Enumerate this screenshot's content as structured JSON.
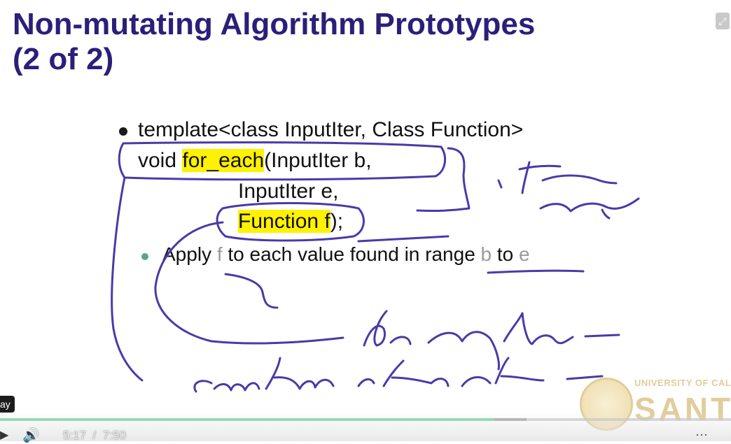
{
  "slide": {
    "title_line1": "Non-mutating Algorithm Prototypes",
    "title_line2": "(2 of 2)",
    "code": {
      "line1": "template<class InputIter, Class Function>",
      "line2_pre": "void ",
      "line2_hl": "for_each",
      "line2_post": "(InputIter b,",
      "line3": "InputIter e,",
      "line4_hl": "Function f",
      "line4_post": ");"
    },
    "sub_bullet": {
      "w1": "Apply ",
      "f": "f",
      "w2": " to each value found in range ",
      "b": "b",
      "w3": " to ",
      "e": "e"
    },
    "colors": {
      "title": "#2b1f7a",
      "highlight": "#fff200",
      "ink": "#4a3aa8",
      "sub_bullet_dot": "#5aa58a"
    }
  },
  "logo": {
    "univ": "UNIVERSITY OF CALI",
    "name": "SANTA CR"
  },
  "player": {
    "tooltip": "ay",
    "current_time": "5:17",
    "separator": "/",
    "duration": "7:50",
    "progress_fraction": 0.676,
    "buffered_fraction": 0.72,
    "play_icon": "play-icon",
    "volume_icon": "volume-icon",
    "menu_icon": "more-icon",
    "share_icon": "share-icon"
  }
}
